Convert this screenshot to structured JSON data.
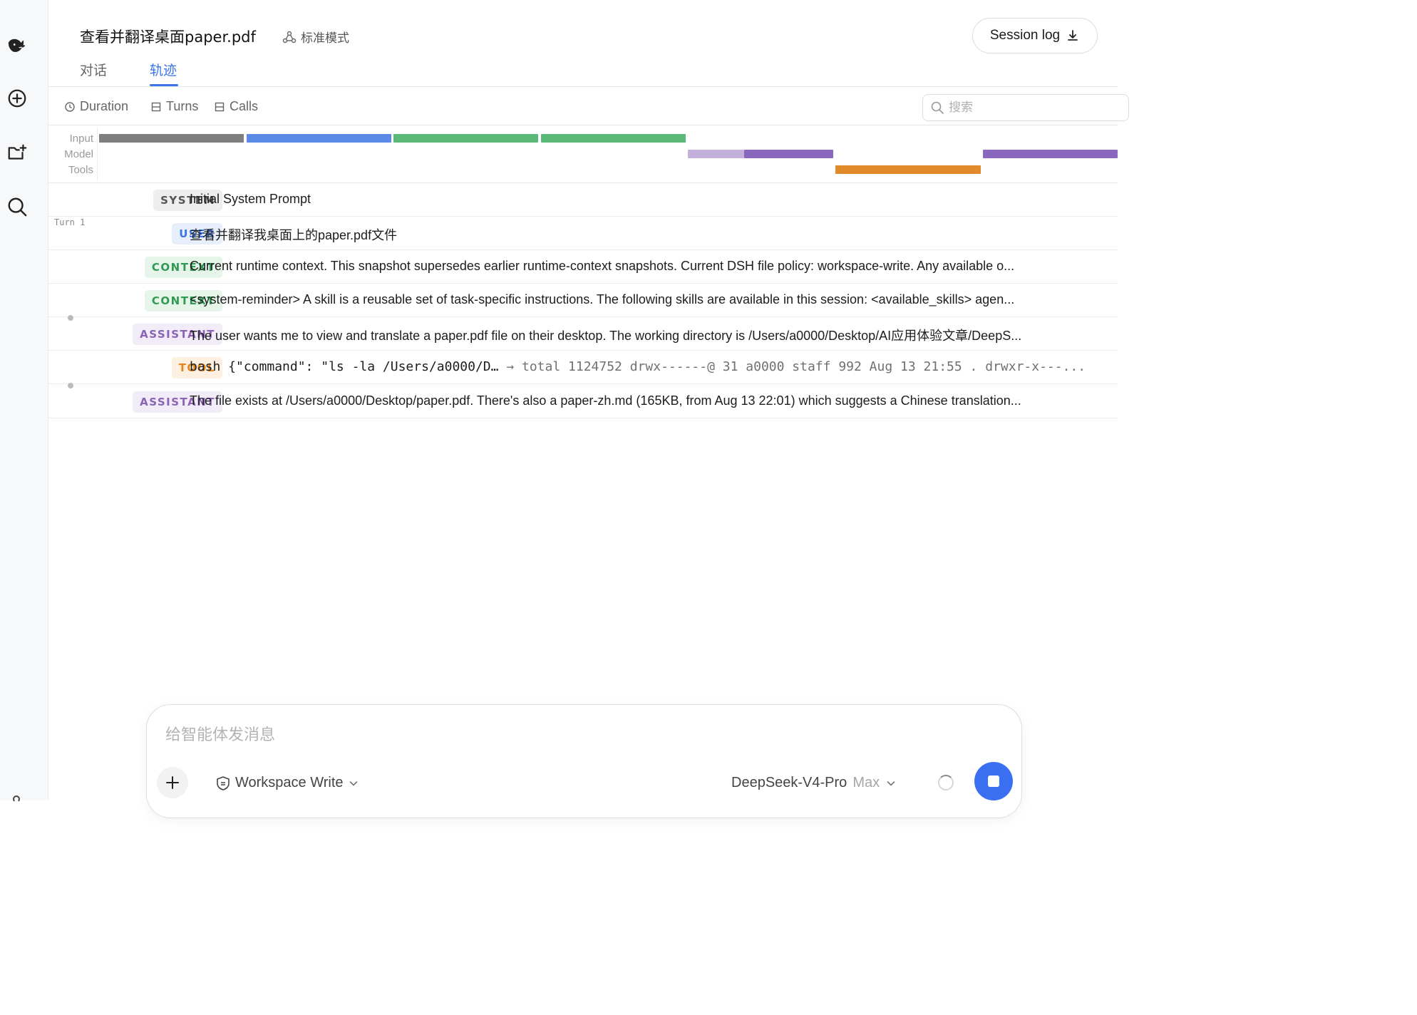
{
  "header": {
    "title": "查看并翻译桌面paper.pdf",
    "mode_label": "标准模式",
    "session_log_label": "Session log"
  },
  "tabs": [
    {
      "label": "对话",
      "active": false
    },
    {
      "label": "轨迹",
      "active": true
    }
  ],
  "toolbar": {
    "items": [
      {
        "label": "Duration",
        "icon": "clock-icon",
        "active": true
      },
      {
        "label": "Turns",
        "icon": "list-icon",
        "active": false
      },
      {
        "label": "Calls",
        "icon": "list-icon",
        "active": false
      }
    ],
    "search_placeholder": "搜索"
  },
  "timeline": {
    "lanes": [
      "Input",
      "Model",
      "Tools"
    ],
    "segments": [
      {
        "lane": "Input",
        "color": "#7f7f7f"
      },
      {
        "lane": "Input",
        "color": "#5b8be6"
      },
      {
        "lane": "Input",
        "color": "#5ab878"
      },
      {
        "lane": "Input",
        "color": "#5ab878"
      },
      {
        "lane": "Model",
        "color": "#c3b1dc"
      },
      {
        "lane": "Model",
        "color": "#8a68bf"
      },
      {
        "lane": "Tools",
        "color": "#e08a2c"
      },
      {
        "lane": "Model",
        "color": "#8a68bf"
      }
    ]
  },
  "trace": {
    "turn_label": "Turn 1",
    "rows": [
      {
        "type": "SYSTEM",
        "text": "Initial System Prompt"
      },
      {
        "type": "USER",
        "text": "查看并翻译我桌面上的paper.pdf文件"
      },
      {
        "type": "CONTEXT",
        "text": "Current runtime context. This snapshot supersedes earlier runtime-context snapshots. Current DSH file policy: workspace-write. Any available o..."
      },
      {
        "type": "CONTEXT",
        "text": "<system-reminder> A skill is a reusable set of task-specific instructions. The following skills are available in this session: <available_skills> agen..."
      },
      {
        "type": "ASSISTANT",
        "text": "The user wants me to view and translate a paper.pdf file on their desktop. The working directory is /Users/a0000/Desktop/AI应用体验文章/DeepS..."
      },
      {
        "type": "TOOL",
        "command": "bash {\"command\": \"ls -la /Users/a0000/D…",
        "output": "→ total 1124752 drwx------@ 31 a0000 staff 992 Aug 13 21:55 . drwxr-x---..."
      },
      {
        "type": "ASSISTANT",
        "text": "The file exists at /Users/a0000/Desktop/paper.pdf. There's also a paper-zh.md (165KB, from Aug 13 22:01) which suggests a Chinese translation..."
      }
    ]
  },
  "composer": {
    "placeholder": "给智能体发消息",
    "permission_label": "Workspace Write",
    "model_name": "DeepSeek-V4-Pro",
    "model_tier": "Max"
  },
  "colors": {
    "accent": "#3a74e8",
    "stop_button": "#3a6ff2"
  }
}
